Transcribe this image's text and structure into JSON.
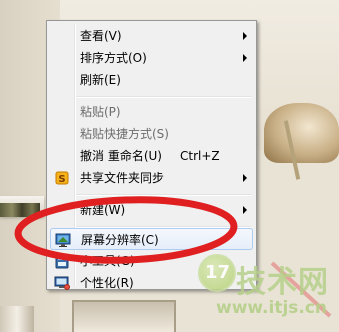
{
  "menu": {
    "items": [
      {
        "label": "查看(V)",
        "disabled": false,
        "submenu": true,
        "shortcut": "",
        "icon": ""
      },
      {
        "label": "排序方式(O)",
        "disabled": false,
        "submenu": true,
        "shortcut": "",
        "icon": ""
      },
      {
        "label": "刷新(E)",
        "disabled": false,
        "submenu": false,
        "shortcut": "",
        "icon": ""
      },
      {
        "label": "粘贴(P)",
        "disabled": true,
        "submenu": false,
        "shortcut": "",
        "icon": ""
      },
      {
        "label": "粘贴快捷方式(S)",
        "disabled": true,
        "submenu": false,
        "shortcut": "",
        "icon": ""
      },
      {
        "label": "撤消 重命名(U)",
        "disabled": false,
        "submenu": false,
        "shortcut": "Ctrl+Z",
        "icon": ""
      },
      {
        "label": "共享文件夹同步",
        "disabled": false,
        "submenu": true,
        "shortcut": "",
        "icon": "sync-icon"
      },
      {
        "label": "新建(W)",
        "disabled": false,
        "submenu": true,
        "shortcut": "",
        "icon": ""
      },
      {
        "label": "屏幕分辨率(C)",
        "disabled": false,
        "submenu": false,
        "shortcut": "",
        "icon": "monitor-icon",
        "highlighted": true
      },
      {
        "label": "小工具(G)",
        "disabled": false,
        "submenu": false,
        "shortcut": "",
        "icon": "gadgets-icon"
      },
      {
        "label": "个性化(R)",
        "disabled": false,
        "submenu": false,
        "shortcut": "",
        "icon": "personalize-icon"
      }
    ]
  },
  "watermark": {
    "logo": "17",
    "title": "技术网",
    "url": "www.itjs.cn"
  },
  "colors": {
    "annotation": "#e02020",
    "highlight_border": "#aecbf0",
    "watermark": "#b6d08a"
  }
}
